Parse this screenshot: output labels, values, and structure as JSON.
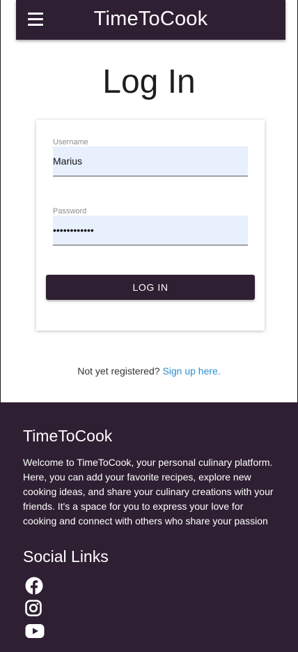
{
  "header": {
    "app_name": "TimeToCook"
  },
  "page": {
    "title": "Log In"
  },
  "form": {
    "username_label": "Username",
    "username_value": "Marius",
    "password_label": "Password",
    "password_value": "••••••••••••",
    "submit_label": "LOG IN"
  },
  "register": {
    "prompt": "Not yet registered?",
    "link_text": "Sign up here."
  },
  "footer": {
    "title": "TimeToCook",
    "description": "Welcome to TimeToCook, your personal culinary platform. Here, you can add your favorite recipes, explore new cooking ideas, and share your culinary creations with your friends. It's a space for you to express your love for cooking and connect with others who share your passion",
    "social_title": "Social Links",
    "social_icons": [
      "facebook-icon",
      "instagram-icon",
      "youtube-icon"
    ]
  },
  "colors": {
    "primary": "#2f1f32",
    "link": "#2a8fd0",
    "input_bg": "#e8f0fe"
  }
}
